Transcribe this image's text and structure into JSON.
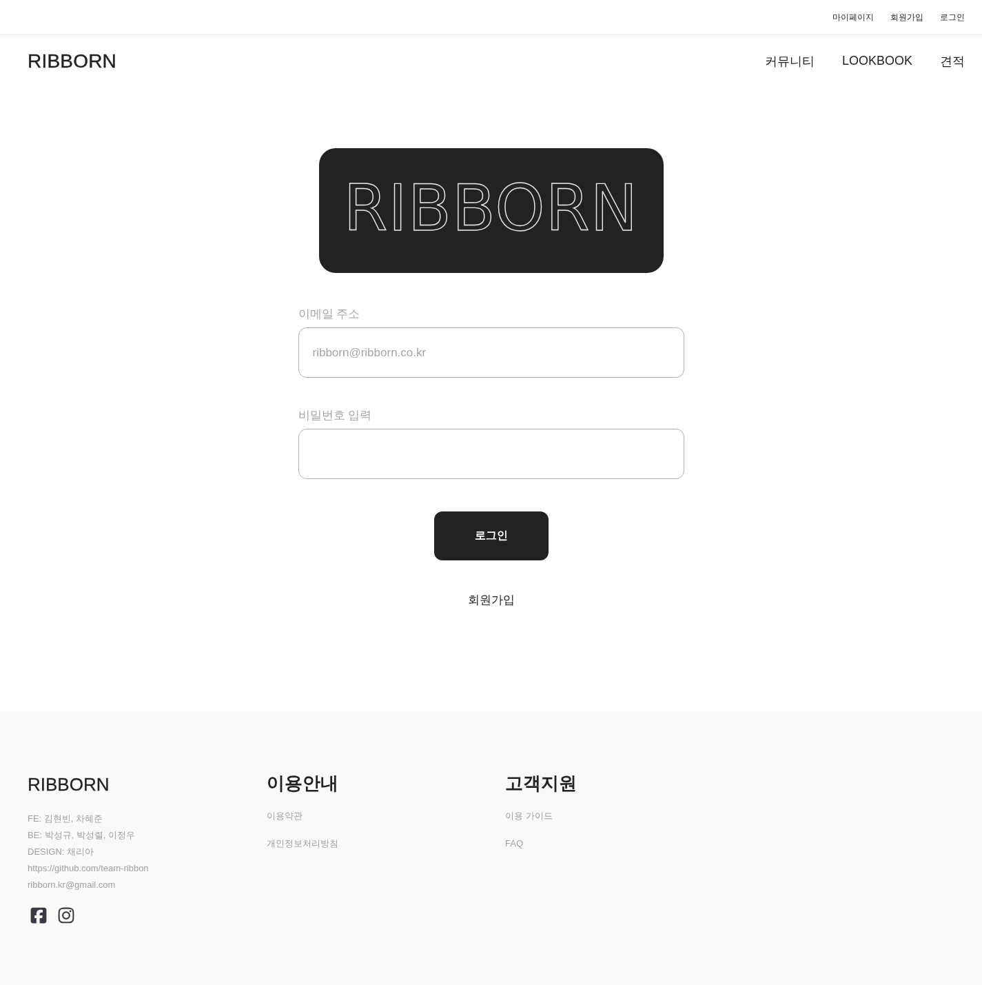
{
  "top_bar": {
    "links": [
      "마이페이지",
      "회원가입",
      "로그인"
    ]
  },
  "header": {
    "logo": "RIBBORN",
    "nav": [
      "커뮤니티",
      "LOOKBOOK",
      "견적"
    ]
  },
  "login": {
    "logo": "RIBBORN",
    "fields": [
      {
        "label": "이메일 주소",
        "placeholder": "ribborn@ribborn.co.kr"
      },
      {
        "label": "비밀번호 입력"
      }
    ],
    "submit": "로그인",
    "signup_link": "회원가입"
  },
  "footer": {
    "logo": "RIBBORN",
    "info": [
      "FE: 김현빈, 차혜준",
      "BE: 박성규, 박성렬, 이정우",
      "DESIGN: 채리아",
      "https://github.com/team-ribbon",
      "ribborn.kr@gmail.com"
    ],
    "columns": [
      {
        "title": "이용안내",
        "links": [
          "이용약관",
          "개인정보처리방침"
        ]
      },
      {
        "title": "고객지원",
        "links": [
          "이용 가이드",
          "FAQ"
        ]
      }
    ]
  }
}
